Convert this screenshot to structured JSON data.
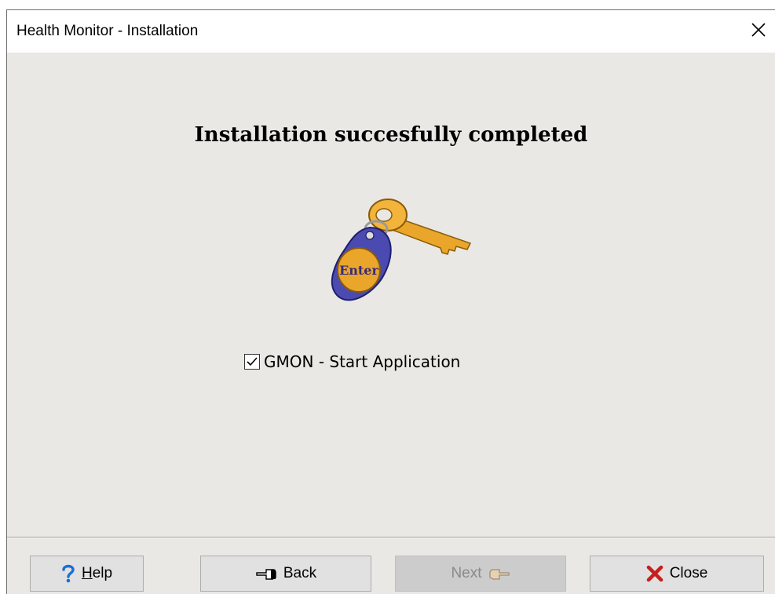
{
  "window": {
    "title": "Health Monitor - Installation"
  },
  "main": {
    "heading": "Installation succesfully completed",
    "key_badge_text": "Enter",
    "checkbox": {
      "label": "GMON - Start Application",
      "checked": true
    }
  },
  "buttons": {
    "help_prefix": "",
    "help_mnemonic": "H",
    "help_rest": "elp",
    "back": "Back",
    "next": "Next",
    "close": "Close"
  },
  "icons": {
    "help": "question-mark-icon",
    "back": "hand-pointing-left-icon",
    "next": "hand-pointing-right-icon",
    "close": "red-x-icon",
    "title_close": "close-icon"
  },
  "colors": {
    "dialog_bg": "#eae8e4",
    "help_icon": "#1b6fd1",
    "close_icon": "#c81e1e",
    "key_gold": "#e9a62a",
    "fob_blue": "#4a4ab0"
  }
}
